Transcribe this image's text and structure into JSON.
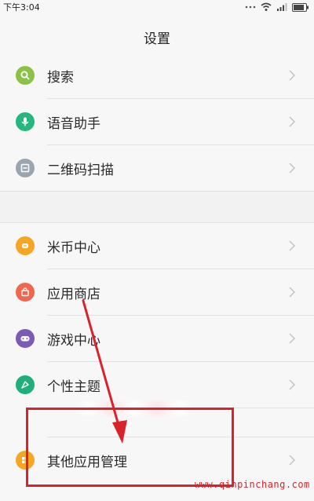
{
  "status_bar": {
    "time": "下午3:04",
    "icons": [
      "more-dots-icon",
      "wifi-icon",
      "signal-icon",
      "battery-icon"
    ]
  },
  "header": {
    "title": "设置"
  },
  "settings": {
    "group1": [
      {
        "label": "搜索",
        "icon": "search-icon",
        "color": "#8bc34a"
      },
      {
        "label": "语音助手",
        "icon": "microphone-icon",
        "color": "#26b67f"
      },
      {
        "label": "二维码扫描",
        "icon": "qr-scan-icon",
        "color": "#9aa5b0"
      }
    ],
    "group2": [
      {
        "label": "米币中心",
        "icon": "coin-icon",
        "color": "#f5a623"
      },
      {
        "label": "应用商店",
        "icon": "shopping-bag-icon",
        "color": "#f0664f"
      },
      {
        "label": "游戏中心",
        "icon": "gamepad-icon",
        "color": "#7b5bb6"
      },
      {
        "label": "个性主题",
        "icon": "brush-icon",
        "color": "#1fae7c"
      }
    ],
    "group3": [
      {
        "label": "其他应用管理",
        "icon": "apps-icon",
        "color": "#f5a623"
      }
    ]
  },
  "annotation": {
    "color": "#d9232b",
    "watermark": "www.qinpinchang.com"
  }
}
